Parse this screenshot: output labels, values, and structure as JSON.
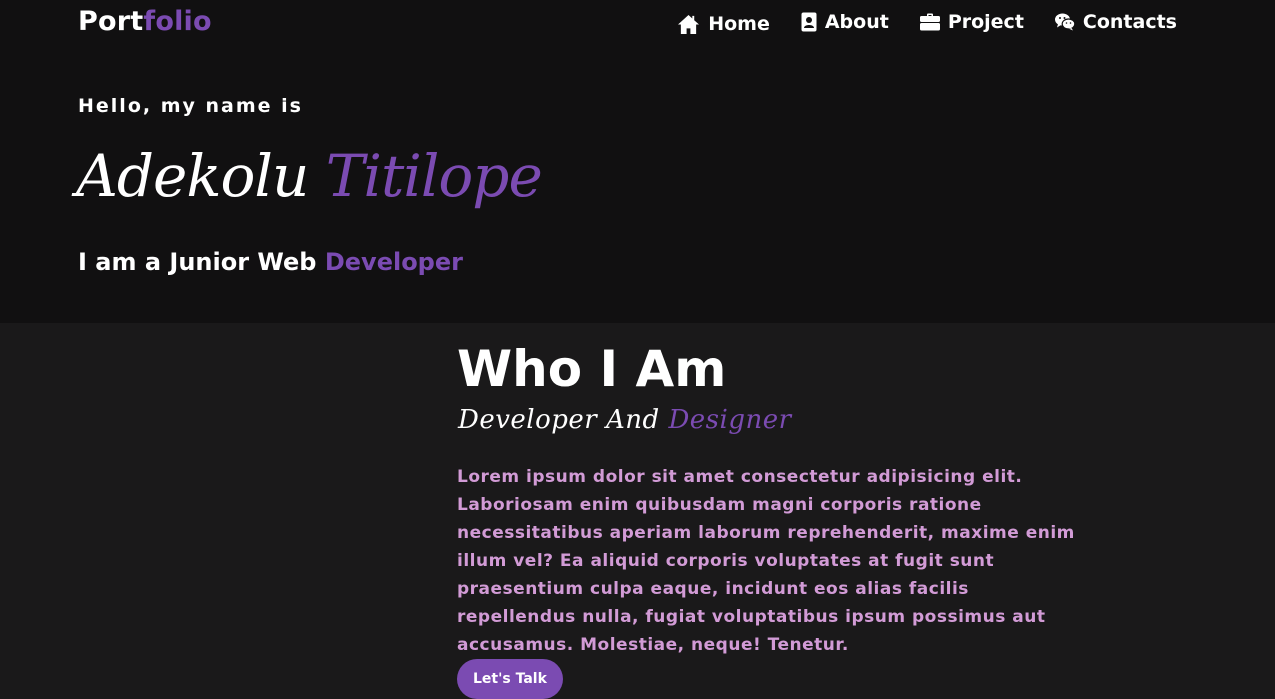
{
  "brand": {
    "part1": "Port",
    "part2": "folio"
  },
  "nav": {
    "items": [
      {
        "label": "Home",
        "icon": "home-icon"
      },
      {
        "label": "About",
        "icon": "contact-card-icon"
      },
      {
        "label": "Project",
        "icon": "briefcase-icon"
      },
      {
        "label": "Contacts",
        "icon": "wechat-icon"
      }
    ]
  },
  "hero": {
    "greeting": "Hello, my name is",
    "first_name": "Adekolu",
    "last_name": "Titilope",
    "role_prefix": "I am a Junior Web",
    "role_accent": "Developer"
  },
  "about": {
    "title": "Who I Am",
    "subtitle_prefix": "Developer And",
    "subtitle_accent": "Designer",
    "text": "Lorem ipsum dolor sit amet consectetur adipisicing elit. Laboriosam enim quibusdam magni corporis ratione necessitatibus aperiam laborum reprehenderit, maxime enim illum vel? Ea aliquid corporis voluptates at fugit sunt praesentium culpa eaque, incidunt eos alias facilis repellendus nulla, fugiat voluptatibus ipsum possimus aut accusamus. Molestiae, neque! Tenetur.",
    "button_label": "Let's Talk"
  },
  "colors": {
    "accent": "#7b4bb2",
    "paragraph": "#d29bd6",
    "hero_background": "#111011",
    "section_background": "#1a191a"
  }
}
